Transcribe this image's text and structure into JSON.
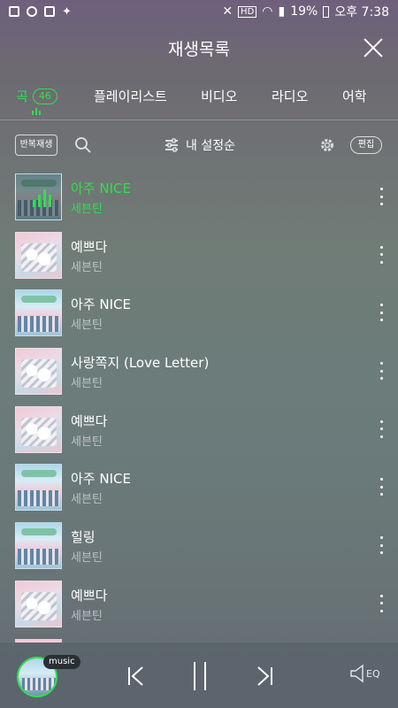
{
  "status_bar": {
    "battery": "19%",
    "time": "오후 7:38"
  },
  "header": {
    "title": "재생목록"
  },
  "tabs": [
    {
      "label": "곡",
      "badge": "46",
      "active": true
    },
    {
      "label": "플레이리스트"
    },
    {
      "label": "비디오"
    },
    {
      "label": "라디오"
    },
    {
      "label": "어학"
    }
  ],
  "toolbar": {
    "repeat_label": "반복재생",
    "sort_label": "내 설정순",
    "edit_label": "편집"
  },
  "songs": [
    {
      "title": "아주 NICE",
      "artist": "세븐틴",
      "playing": true
    },
    {
      "title": "예쁘다",
      "artist": "세븐틴"
    },
    {
      "title": "아주 NICE",
      "artist": "세븐틴"
    },
    {
      "title": "사랑쪽지 (Love Letter)",
      "artist": "세븐틴"
    },
    {
      "title": "예쁘다",
      "artist": "세븐틴"
    },
    {
      "title": "아주 NICE",
      "artist": "세븐틴"
    },
    {
      "title": "힐링",
      "artist": "세븐틴"
    },
    {
      "title": "예쁘다",
      "artist": "세븐틴"
    }
  ],
  "player": {
    "badge": "music",
    "eq_label": "EQ"
  },
  "colors": {
    "accent": "#2ee04f"
  }
}
